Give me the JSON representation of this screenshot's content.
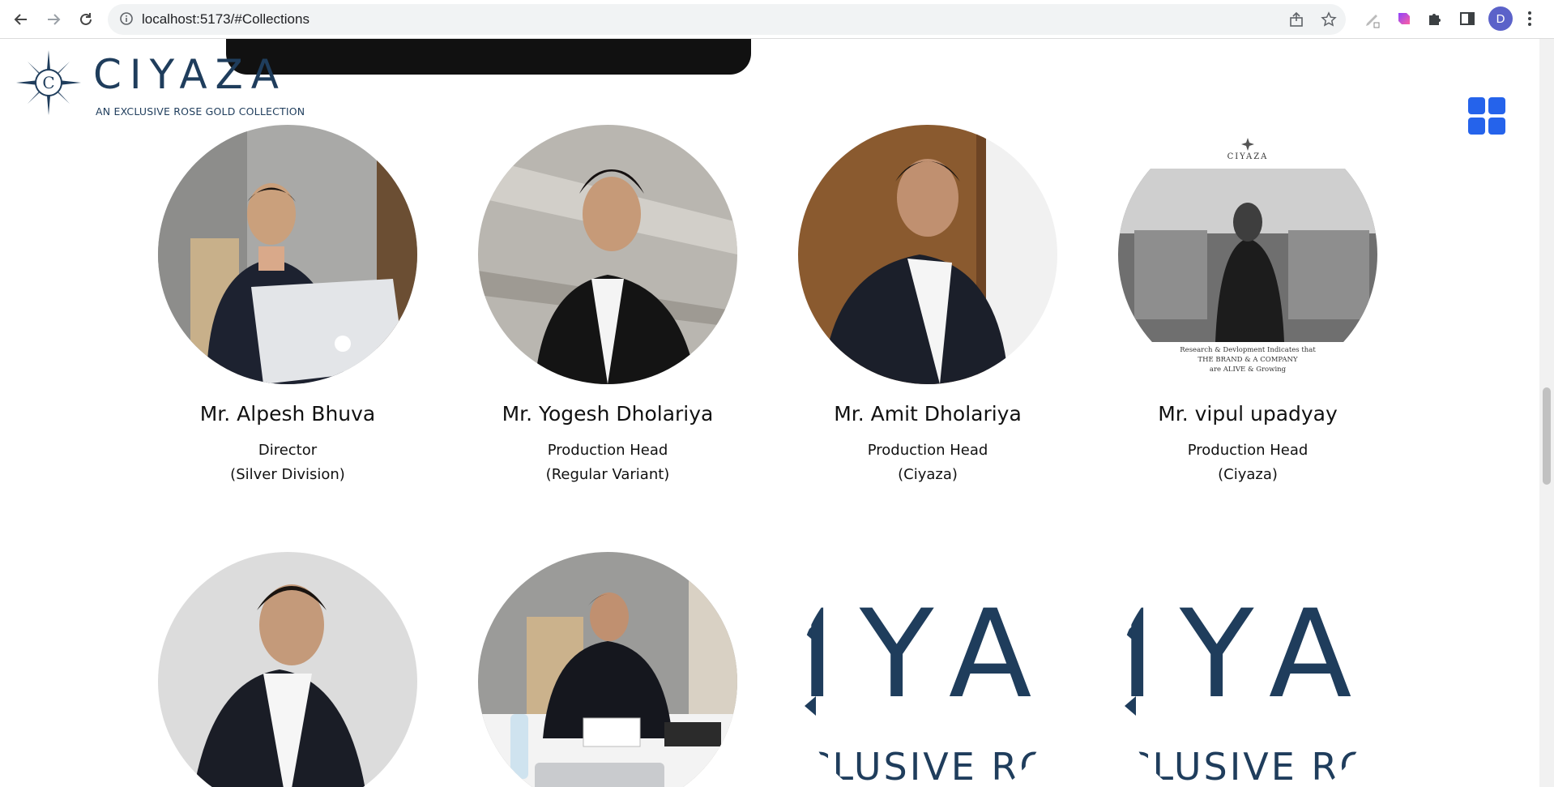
{
  "browser": {
    "url": "localhost:5173/#Collections",
    "profile_initial": "D"
  },
  "brand": {
    "name": "CIYAZA",
    "tagline": "AN EXCLUSIVE ROSE GOLD COLLECTION",
    "primary_color": "#1f3d5c",
    "accent_color": "#2563eb"
  },
  "team": [
    {
      "name": "Mr. Alpesh Bhuva",
      "role_line1": "Director",
      "role_line2": "(Silver Division)"
    },
    {
      "name": "Mr. Yogesh Dholariya",
      "role_line1": "Production Head",
      "role_line2": "(Regular Variant)"
    },
    {
      "name": "Mr. Amit Dholariya",
      "role_line1": "Production Head",
      "role_line2": "(Ciyaza)"
    },
    {
      "name": "Mr. vipul upadyay",
      "role_line1": "Production Head",
      "role_line2": "(Ciyaza)"
    }
  ],
  "poster": {
    "brand": "CIYAZA",
    "caption_line1": "Research & Devlopment Indicates that",
    "caption_line2": "THE BRAND & A COMPANY",
    "caption_line3": "are ALIVE & Growing"
  },
  "placeholder": {
    "letters": "IYA",
    "tagline_fragment": "CLUSIVE RO"
  }
}
